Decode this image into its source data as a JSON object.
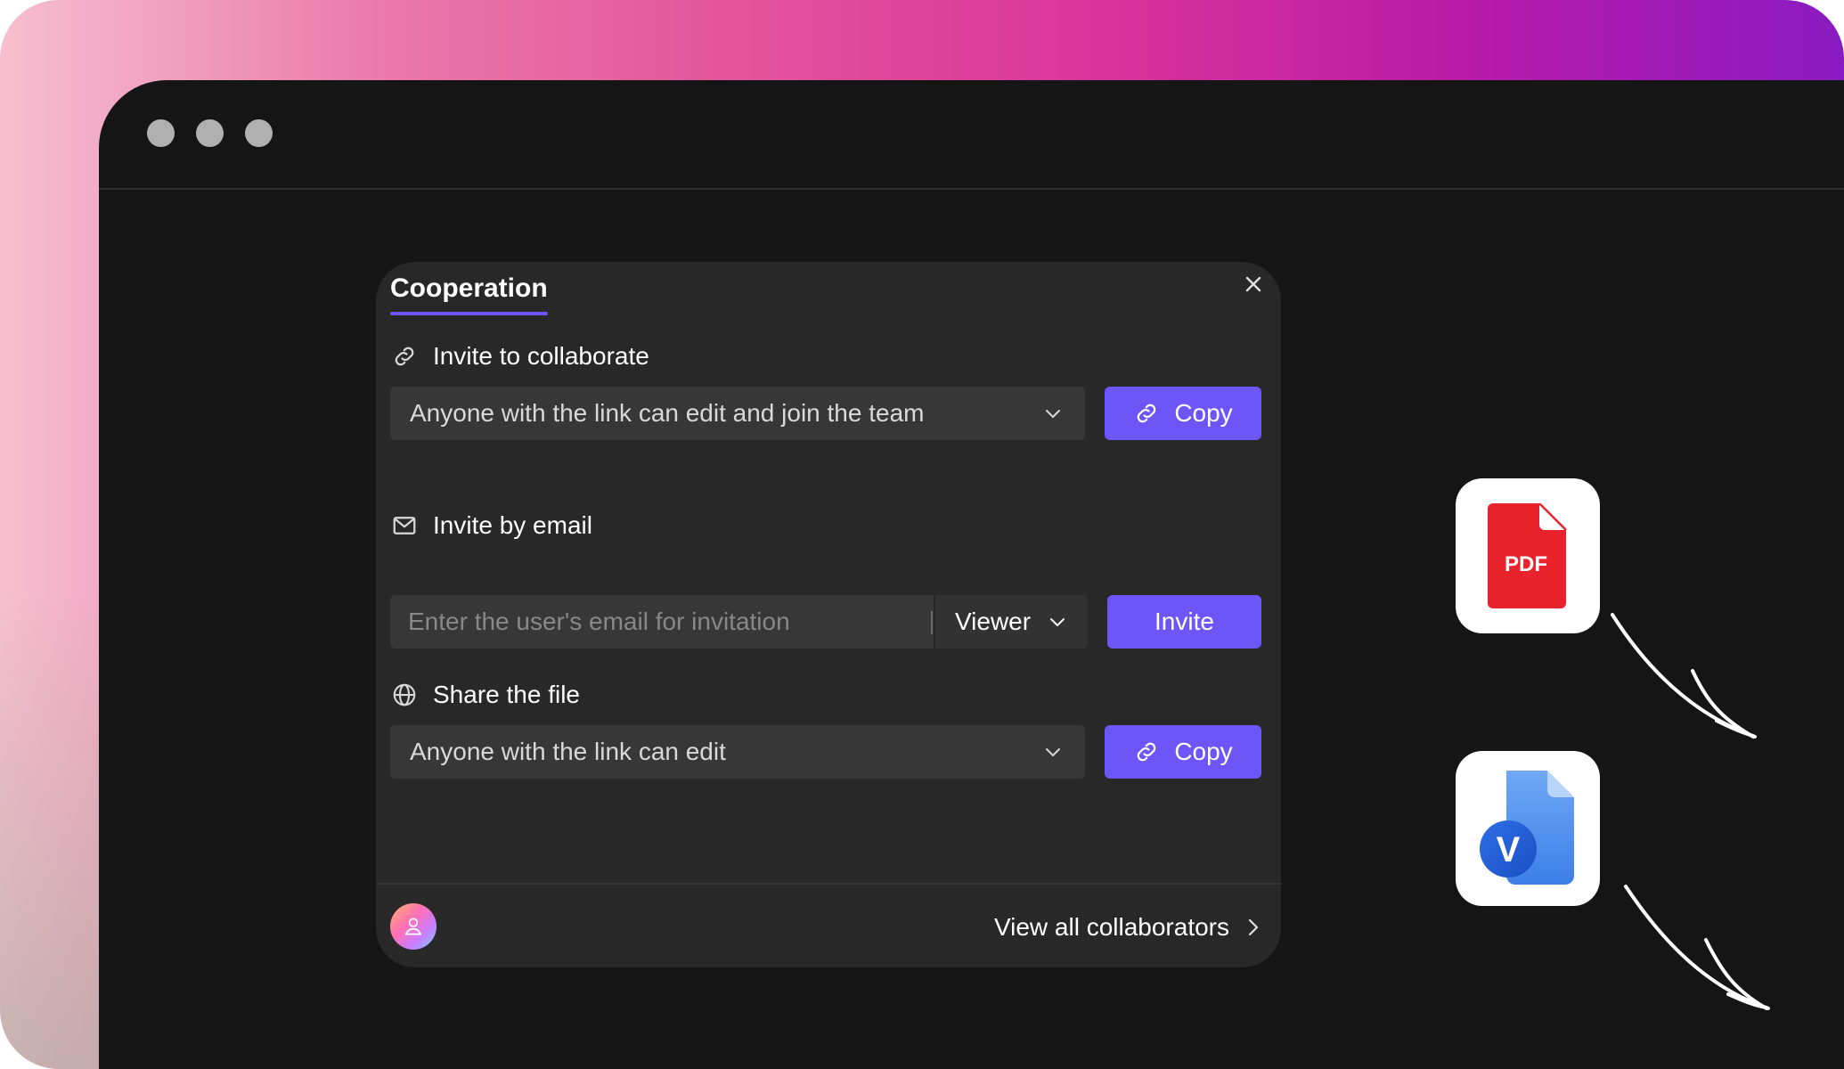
{
  "dialog": {
    "title": "Cooperation",
    "sections": {
      "collaborate": {
        "label": "Invite to collaborate",
        "select_value": "Anyone with the link can edit and join the team",
        "button_label": "Copy"
      },
      "email": {
        "label": "Invite by email",
        "placeholder": "Enter the user's email for invitation",
        "role_value": "Viewer",
        "button_label": "Invite"
      },
      "share": {
        "label": "Share the file",
        "select_value": "Anyone with the link can edit",
        "button_label": "Copy"
      }
    },
    "footer": {
      "view_all_label": "View all collaborators"
    }
  },
  "apps": {
    "pdf_label": "PDF",
    "visio_label": "V"
  },
  "colors": {
    "accent": "#6e55f8",
    "dialog_bg": "#282829",
    "window_bg": "#151516",
    "pdf_red": "#e8232b",
    "visio_blue": "#2f6ee6"
  },
  "icons": [
    "close-icon",
    "link-icon",
    "mail-icon",
    "globe-icon",
    "chevron-down-icon",
    "chevron-right-icon",
    "user-icon",
    "pdf-file-icon",
    "visio-file-icon"
  ]
}
